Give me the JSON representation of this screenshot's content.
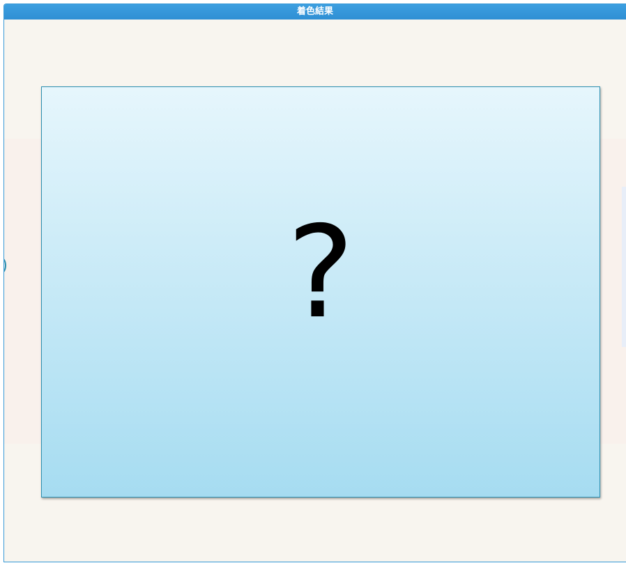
{
  "window": {
    "title": "着色結果"
  },
  "result": {
    "placeholder_symbol": "?"
  },
  "colors": {
    "title_bar": "#3394d8",
    "background": "#f8f5ef",
    "panel_top": "#e6f6fc",
    "panel_bottom": "#a6dcf1",
    "panel_border": "#2b8fb0"
  }
}
